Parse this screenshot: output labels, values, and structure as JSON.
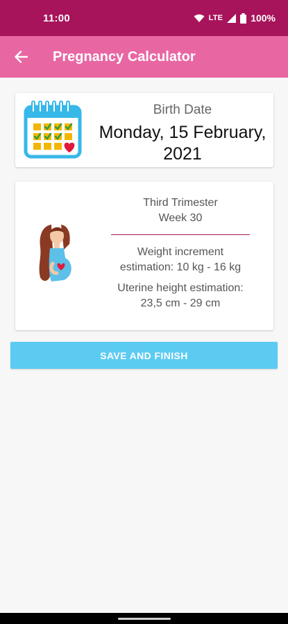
{
  "status_bar": {
    "time": "11:00",
    "network": "LTE",
    "battery": "100%"
  },
  "app_bar": {
    "title": "Pregnancy Calculator"
  },
  "birth_card": {
    "label": "Birth Date",
    "value": "Monday, 15 February, 2021"
  },
  "info_card": {
    "trimester": "Third Trimester",
    "week": "Week 30",
    "weight_label": "Weight increment",
    "weight_value": "estimation: 10 kg - 16 kg",
    "uterine_label": "Uterine height estimation:",
    "uterine_value": "23,5 cm - 29 cm"
  },
  "actions": {
    "save_label": "SAVE AND FINISH"
  },
  "colors": {
    "status_bar": "#a8145b",
    "app_bar": "#e867a3",
    "button": "#5ccbf2",
    "divider": "#a8145b"
  },
  "icons": [
    "wifi-icon",
    "signal-icon",
    "battery-icon",
    "back-arrow-icon",
    "calendar-icon",
    "pregnant-woman-icon"
  ]
}
